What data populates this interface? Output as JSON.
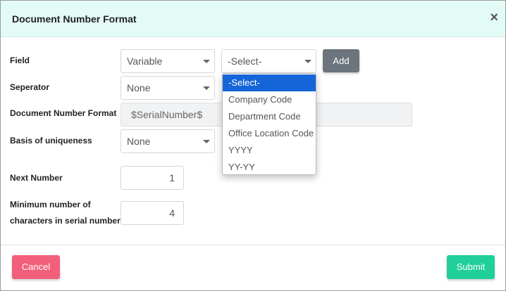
{
  "header": {
    "title": "Document Number Format",
    "close_label": "×"
  },
  "form": {
    "labels": {
      "field": "Field",
      "separator": "Seperator",
      "doc_number_format": "Document Number Format",
      "basis_uniqueness": "Basis of uniqueness",
      "next_number": "Next Number",
      "min_chars_line1": "Minimum number of",
      "min_chars_line2": "characters in serial number"
    },
    "field_type_value": "Variable",
    "field_variable_value": "-Select-",
    "add_button_label": "Add",
    "separator_value": "None",
    "format_value": "$SerialNumber$",
    "basis_value": "None",
    "next_number_value": "1",
    "min_chars_value": "4"
  },
  "dropdown": {
    "items": [
      "-Select-",
      "Company Code",
      "Department Code",
      "Office Location Code",
      "YYYY",
      "YY-YY"
    ],
    "selected_index": 0
  },
  "footer": {
    "cancel_label": "Cancel",
    "submit_label": "Submit"
  },
  "colors": {
    "header_bg": "#e3fbf6",
    "add_button": "#6c757d",
    "cancel_button": "#f25f7a",
    "submit_button": "#20cf99",
    "dropdown_selected": "#1565d8"
  }
}
